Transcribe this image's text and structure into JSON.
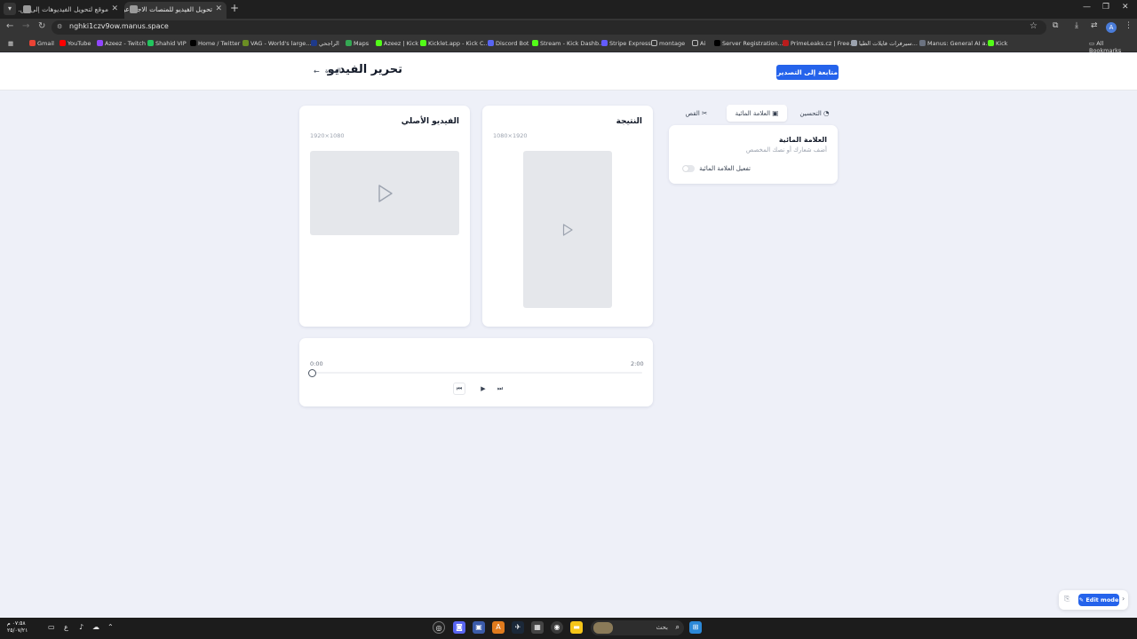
{
  "browser": {
    "tabs": [
      {
        "title": "موقع لتحويل الفيديوهات إلى ص...",
        "active": false
      },
      {
        "title": "تحويل الفيديو للمنصات الاجتماعية",
        "active": true
      }
    ],
    "url": "nghki1czv9ow.manus.space",
    "profile_initial": "A",
    "bookmarks": [
      {
        "label": "Gmail",
        "color": "#ea4335"
      },
      {
        "label": "YouTube",
        "color": "#ff0000"
      },
      {
        "label": "Azeez - Twitch",
        "color": "#9146ff"
      },
      {
        "label": "Shahid VIP",
        "color": "#22c55e"
      },
      {
        "label": "Home / Twitter",
        "color": "#000000"
      },
      {
        "label": "VAG - World's large...",
        "color": "#6b8e23"
      },
      {
        "label": "الراجحي",
        "color": "#1e3a8a"
      },
      {
        "label": "Maps",
        "color": "#34a853"
      },
      {
        "label": "Azeez | Kick",
        "color": "#53fc18"
      },
      {
        "label": "Kicklet.app - Kick C...",
        "color": "#53fc18"
      },
      {
        "label": "Discord Bot",
        "color": "#5865f2"
      },
      {
        "label": "Stream - Kick Dashb...",
        "color": "#53fc18"
      },
      {
        "label": "Stripe Express",
        "color": "#635bff"
      },
      {
        "label": "montage",
        "color": "#9ca3af"
      },
      {
        "label": "Ai",
        "color": "#9ca3af"
      },
      {
        "label": "Server Registration...",
        "color": "#000000"
      },
      {
        "label": "PrimeLeaks.cz | Free...",
        "color": "#b91c1c"
      },
      {
        "label": "سيرفرات فايلات الطيا...",
        "color": "#9ca3af"
      },
      {
        "label": "Manus: General AI a...",
        "color": "#6b7280"
      },
      {
        "label": "Kick",
        "color": "#53fc18"
      }
    ],
    "all_bookmarks_label": "All Bookmarks"
  },
  "header": {
    "export_label": "متابعة إلى التصدير",
    "title": "تحرير الفيديو",
    "back_label": "العودة"
  },
  "original_card": {
    "title": "الفيديو الأصلي",
    "dimensions": "1920×1080"
  },
  "result_card": {
    "title": "النتيجة",
    "dimensions": "1080×1920"
  },
  "timeline": {
    "start_time": "0:00",
    "end_time": "2:00",
    "progress": 0
  },
  "side_tabs": {
    "enhance_label": "التحسين",
    "watermark_label": "العلامة المائية",
    "crop_label": "القص"
  },
  "watermark_panel": {
    "title": "العلامة المائية",
    "subtitle": "أضف شعارك أو نصك المخصص",
    "toggle_label": "تفعيل العلامة المائية",
    "enabled": false
  },
  "edit_widget": {
    "label": "Edit mode"
  },
  "taskbar": {
    "time": "٠٧:٥٨ م",
    "date": "٢٥/٠٧/٢١",
    "lang": "ع",
    "search_placeholder": "بحث"
  },
  "colors": {
    "accent": "#2563eb",
    "page_bg": "#eef0f8"
  }
}
